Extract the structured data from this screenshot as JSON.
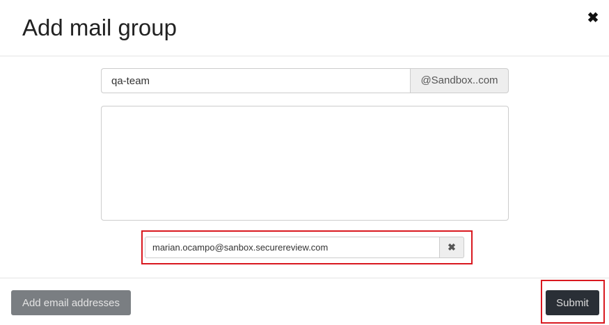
{
  "modal": {
    "title": "Add mail group",
    "close_icon": "close-icon",
    "close_glyph": "✖"
  },
  "form": {
    "group_name_value": "qa-team",
    "domain_suffix": "@Sandbox..com",
    "members_text": "",
    "email_entry_value": "marian.ocampo@sanbox.securereview.com",
    "email_remove_glyph": "✖",
    "email_remove_icon": "remove-icon"
  },
  "footer": {
    "add_emails_label": "Add email addresses",
    "submit_label": "Submit"
  },
  "colors": {
    "highlight": "#d9181f",
    "submit_bg": "#2a2f36",
    "secondary_bg": "#7a7e82"
  }
}
